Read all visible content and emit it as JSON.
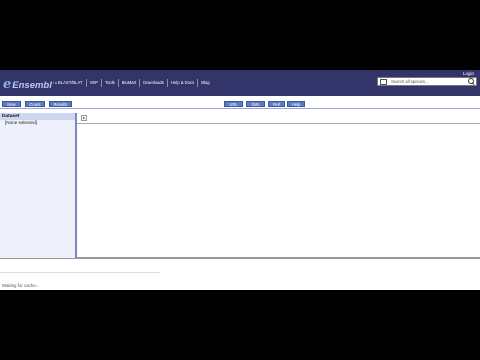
{
  "header": {
    "logo_text": "Ensembl",
    "logo_suffix": "TM",
    "login_label": "Login",
    "nav": [
      "BLAST/BLAT",
      "VEP",
      "Tools",
      "BioMart",
      "Downloads",
      "Help & Docs",
      "Blog"
    ],
    "search_placeholder": "Search all species..."
  },
  "toolbar": {
    "new_label": "New",
    "count_label": "Count",
    "results_label": "Results",
    "url_label": "URL",
    "xml_label": "XML",
    "perl_label": "Perl",
    "help_label": "Help"
  },
  "sidebar": {
    "heading": "Dataset",
    "value": "[None selected]"
  },
  "content": {
    "arrow_glyph": "▸"
  },
  "status": {
    "text": "Waiting for cache..."
  },
  "colors": {
    "header_bg": "#33346a",
    "button_bg": "#5a7bc2",
    "sidebar_bg": "#eef0fb"
  }
}
